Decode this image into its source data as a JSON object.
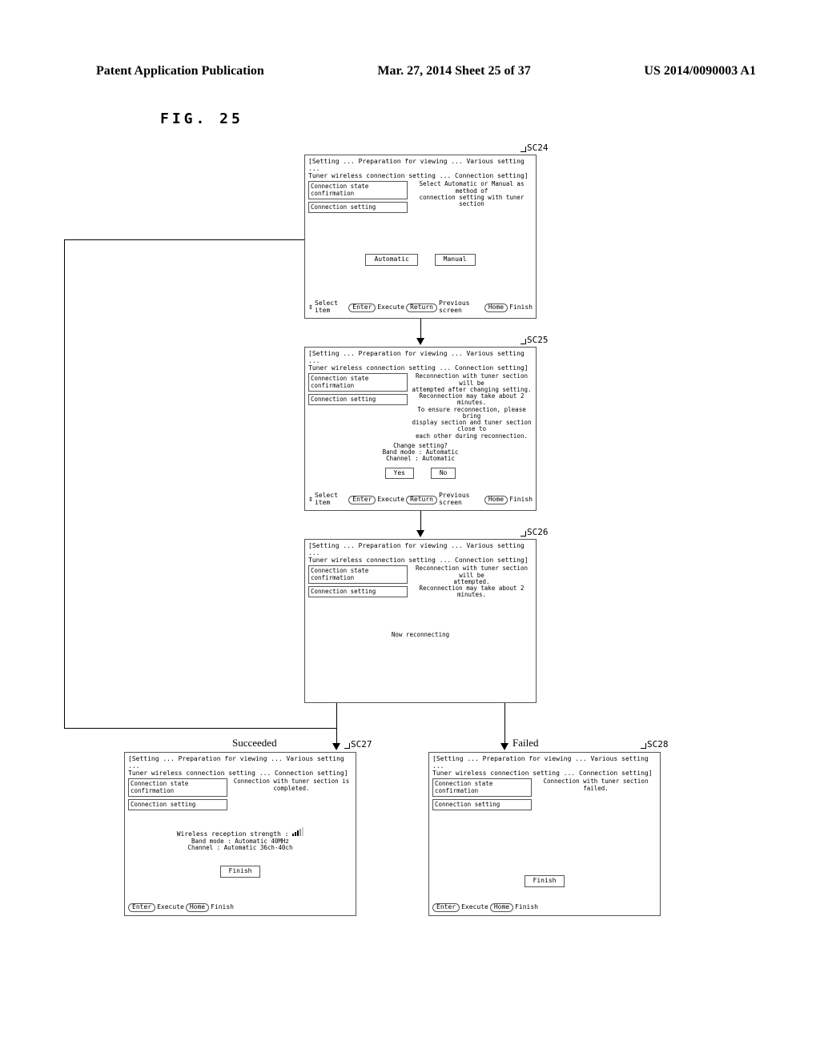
{
  "header": {
    "left": "Patent Application Publication",
    "center": "Mar. 27, 2014  Sheet 25 of 37",
    "right": "US 2014/0090003 A1"
  },
  "figure_label": "FIG. 25",
  "labels": {
    "sc24": "SC24",
    "sc25": "SC25",
    "sc26": "SC26",
    "sc27": "SC27",
    "sc28": "SC28",
    "succeeded": "Succeeded",
    "failed": "Failed"
  },
  "common": {
    "breadcrumb": "[Setting ... Preparation for viewing ... Various setting ...\nTuner wireless connection setting ... Connection setting]",
    "side_confirm": "Connection state confirmation",
    "side_setting": "Connection setting",
    "hint_select": "Select item",
    "hint_enter": "Enter",
    "hint_execute": "Execute",
    "hint_return": "Return",
    "hint_prev": "Previous screen",
    "hint_home": "Home",
    "hint_finish": "Finish"
  },
  "sc24": {
    "msg": "Select Automatic or Manual as method of\nconnection setting with tuner section",
    "btn_auto": "Automatic",
    "btn_manual": "Manual"
  },
  "sc25": {
    "msg": "Reconnection with tuner section will be\nattempted after changing setting.\nReconnection may take about 2 minutes.\nTo ensure reconnection, please bring\ndisplay section and tuner section close to\neach other during reconnection.",
    "q": "Change setting?",
    "band": "Band mode : Automatic",
    "channel": "Channel : Automatic",
    "yes": "Yes",
    "no": "No"
  },
  "sc26": {
    "msg": "Reconnection with tuner section will be\nattempted.\nReconnection may take about 2 minutes.",
    "status": "Now reconnecting"
  },
  "sc27": {
    "msg": "Connection with tuner section is completed.",
    "strength_label": "Wireless reception strength :",
    "band": "Band mode : Automatic 40MHz",
    "channel": "Channel : Automatic 36ch-40ch",
    "finish": "Finish"
  },
  "sc28": {
    "msg": "Connection with tuner section failed.",
    "finish": "Finish"
  }
}
